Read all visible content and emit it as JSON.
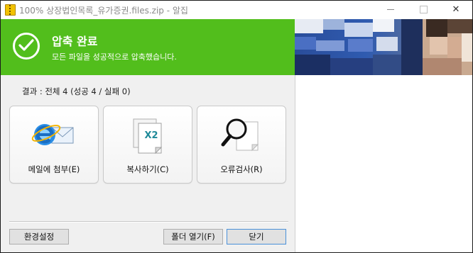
{
  "window": {
    "title": "100% 상장법인목록_유가증권.files.zip - 알집",
    "minimize_glyph": "—",
    "maximize_glyph": "□",
    "close_glyph": "✕"
  },
  "banner": {
    "title": "압축 완료",
    "subtitle": "모든 파일을 성공적으로 압축했습니다.",
    "color": "#52be1c"
  },
  "result": {
    "text": "결과 : 전체 4 (성공 4 / 실패 0)"
  },
  "actions": [
    {
      "label": "메일에 첨부(E)",
      "icon": "mail-ie-icon"
    },
    {
      "label": "복사하기(C)",
      "icon": "copy-x2-icon",
      "badge": "X2"
    },
    {
      "label": "오류검사(R)",
      "icon": "magnifier-icon"
    }
  ],
  "footer": {
    "settings_label": "환경설정",
    "open_folder_label": "폴더 열기(F)",
    "close_label": "닫기"
  }
}
